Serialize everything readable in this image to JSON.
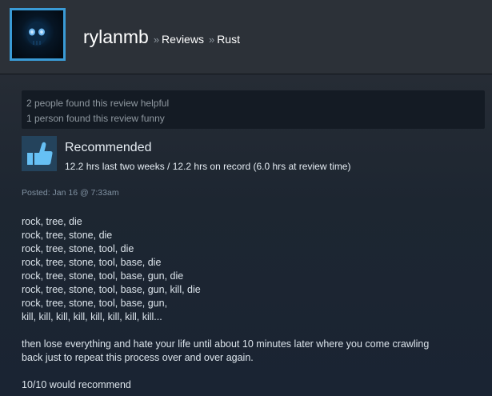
{
  "header": {
    "user_name": "rylanmb",
    "sep1": "»",
    "reviews_label": "Reviews",
    "sep2": "»",
    "game_label": "Rust"
  },
  "feedback": {
    "helpful": "2 people found this review helpful",
    "funny": "1 person found this review funny"
  },
  "recommendation": {
    "title": "Recommended",
    "hours": "12.2 hrs last two weeks / 12.2 hrs on record (6.0 hrs at review time)",
    "icon": "thumbs-up-icon"
  },
  "posted": "Posted: Jan 16 @ 7:33am",
  "review": {
    "lines": [
      "rock, tree, die",
      "rock, tree, stone, die",
      "rock, tree, stone, tool, die",
      "rock, tree, stone, tool, base, die",
      "rock, tree, stone, tool, base, gun, die",
      "rock, tree, stone, tool, base, gun, kill, die",
      "rock, tree, stone, tool, base, gun,",
      "kill, kill, kill, kill, kill, kill, kill, kill..."
    ],
    "paragraph_line1": "then lose everything and hate your life until about 10 minutes later where you come crawling",
    "paragraph_line2": "back just to repeat this process over and over again.",
    "verdict": "10/10 would recommend"
  },
  "colors": {
    "background": "#1b2838",
    "header": "#2c3138",
    "accent_blue": "#3a9bd6",
    "thumb_bg": "#24435c"
  }
}
